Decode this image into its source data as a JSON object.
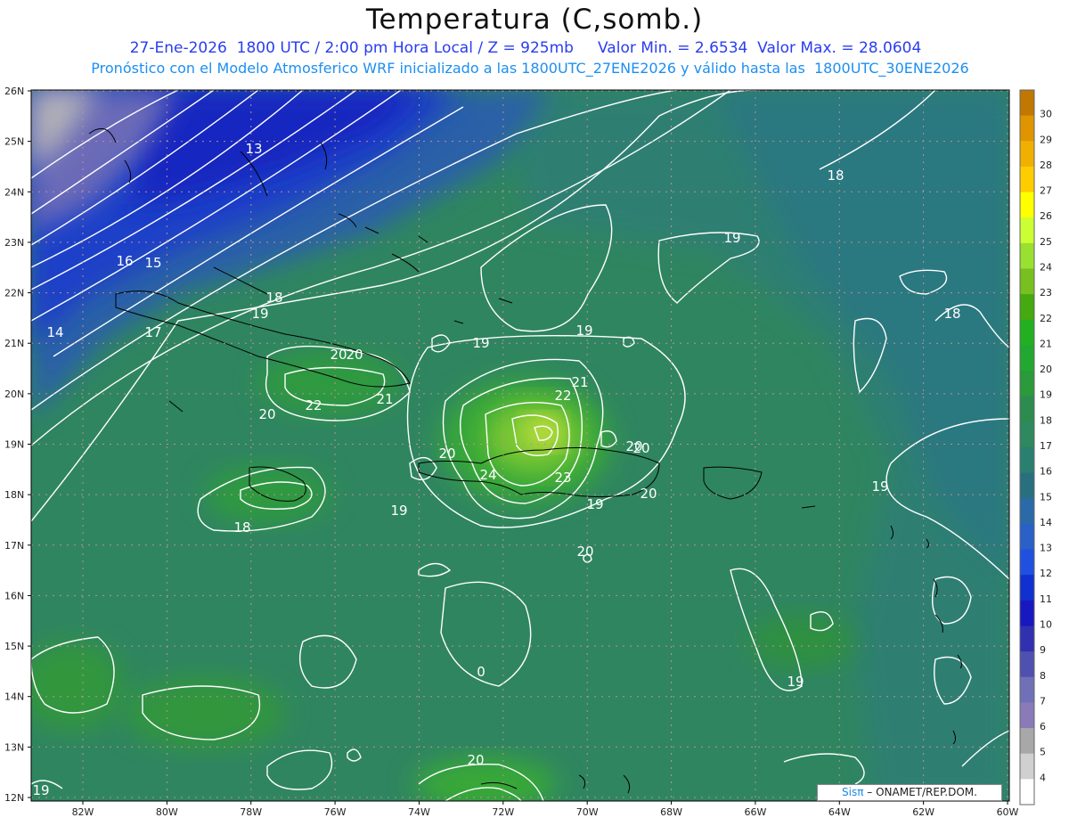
{
  "header": {
    "title": "Temperatura (C,somb.)",
    "subtitle": "27-Ene-2026  1800 UTC / 2:00 pm Hora Local / Z = 925mb     Valor Min. = 2.6534  Valor Max. = 28.0604",
    "model_line": "Pronóstico con el Modelo Atmosferico WRF inicializado a las 1800UTC_27ENE2026 y válido hasta las  1800UTC_30ENE2026"
  },
  "axes": {
    "lat_labels": [
      "26N",
      "25N",
      "24N",
      "23N",
      "22N",
      "21N",
      "20N",
      "19N",
      "18N",
      "17N",
      "16N",
      "15N",
      "14N",
      "13N",
      "12N"
    ],
    "lon_labels": [
      "82W",
      "80W",
      "78W",
      "76W",
      "74W",
      "72W",
      "70W",
      "68W",
      "66W",
      "64W",
      "62W",
      "60W"
    ]
  },
  "colorbar": {
    "labels": [
      "30",
      "29",
      "28",
      "27",
      "26",
      "25",
      "24",
      "23",
      "22",
      "21",
      "20",
      "19",
      "18",
      "17",
      "16",
      "15",
      "14",
      "13",
      "12",
      "11",
      "10",
      "9",
      "8",
      "7",
      "6",
      "5",
      "4"
    ],
    "colors": [
      "#c07800",
      "#e09400",
      "#f0b000",
      "#ffcc00",
      "#ffff00",
      "#ccff33",
      "#99e030",
      "#77c020",
      "#44aa10",
      "#22b020",
      "#22a830",
      "#2a9a3a",
      "#2c8c50",
      "#2e8860",
      "#2a8070",
      "#287080",
      "#2a6aa8",
      "#2a60c8",
      "#2050e0",
      "#1030d0",
      "#1818c0",
      "#3030b0",
      "#5050b0",
      "#7070b8",
      "#8a7ab8",
      "#a8a8a8",
      "#d0d0d0",
      "#ffffff"
    ]
  },
  "contour_labels": [
    {
      "text": "13"
    },
    {
      "text": "18"
    },
    {
      "text": "19"
    },
    {
      "text": "16"
    },
    {
      "text": "15"
    },
    {
      "text": "18"
    },
    {
      "text": "19"
    },
    {
      "text": "14"
    },
    {
      "text": "17"
    },
    {
      "text": "20"
    },
    {
      "text": "22"
    },
    {
      "text": "21"
    },
    {
      "text": "20"
    },
    {
      "text": "19"
    },
    {
      "text": "19"
    },
    {
      "text": "21"
    },
    {
      "text": "22"
    },
    {
      "text": "20"
    },
    {
      "text": "24"
    },
    {
      "text": "23"
    },
    {
      "text": "20"
    },
    {
      "text": "20"
    },
    {
      "text": "19"
    },
    {
      "text": "19"
    },
    {
      "text": "19"
    },
    {
      "text": "18"
    },
    {
      "text": "18"
    },
    {
      "text": "20"
    },
    {
      "text": "0"
    },
    {
      "text": "19"
    },
    {
      "text": "19"
    },
    {
      "text": "20"
    },
    {
      "text": "20"
    },
    {
      "text": "20"
    }
  ],
  "footer": {
    "brand": "Sisπ",
    "credit": " – ONAMET/REP.DOM."
  }
}
